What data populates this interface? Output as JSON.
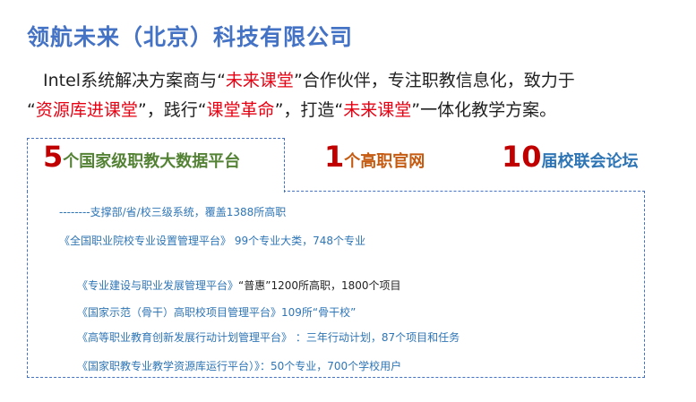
{
  "title": "领航未来（北京）科技有限公司",
  "intro": {
    "line1": {
      "a": "Intel系统解决方案商与“",
      "b": "未来课堂",
      "c": "”合作伙伴，专注职教信息化，致力于"
    },
    "line2": {
      "a": "“",
      "b": "资源库进课堂",
      "c": "”，践行“",
      "d": "课堂革命",
      "e": "”，打造“",
      "f": "未来课堂",
      "g": "”一体化教学方案。"
    }
  },
  "stats": [
    {
      "num": "5",
      "label": "个国家级职教大数据平台"
    },
    {
      "num": "1",
      "label": "个高职官网"
    },
    {
      "num": "10",
      "label": "届校联会论坛"
    }
  ],
  "items": [
    {
      "text": "--------支撑部/省/校三级系统，覆盖1388所高职",
      "extra": ""
    },
    {
      "text": "《全国职业院校专业设置管理平台》",
      "extra": " 99个专业大类，748个专业"
    },
    {
      "text": "《专业建设与职业发展管理平台》",
      "extra": "“普惠”1200所高职，1800个项目"
    },
    {
      "text": "《国家示范（骨干）高职校项目管理平台》109所“骨干校”",
      "extra": ""
    },
    {
      "text": "《高等职业教育创新发展行动计划管理平台》",
      "extra": "  ：三年行动计划，87个项目和任务"
    },
    {
      "text": "《国家职教专业教学资源库运行平台）》：50个专业，700个学校用户",
      "extra": ""
    }
  ]
}
